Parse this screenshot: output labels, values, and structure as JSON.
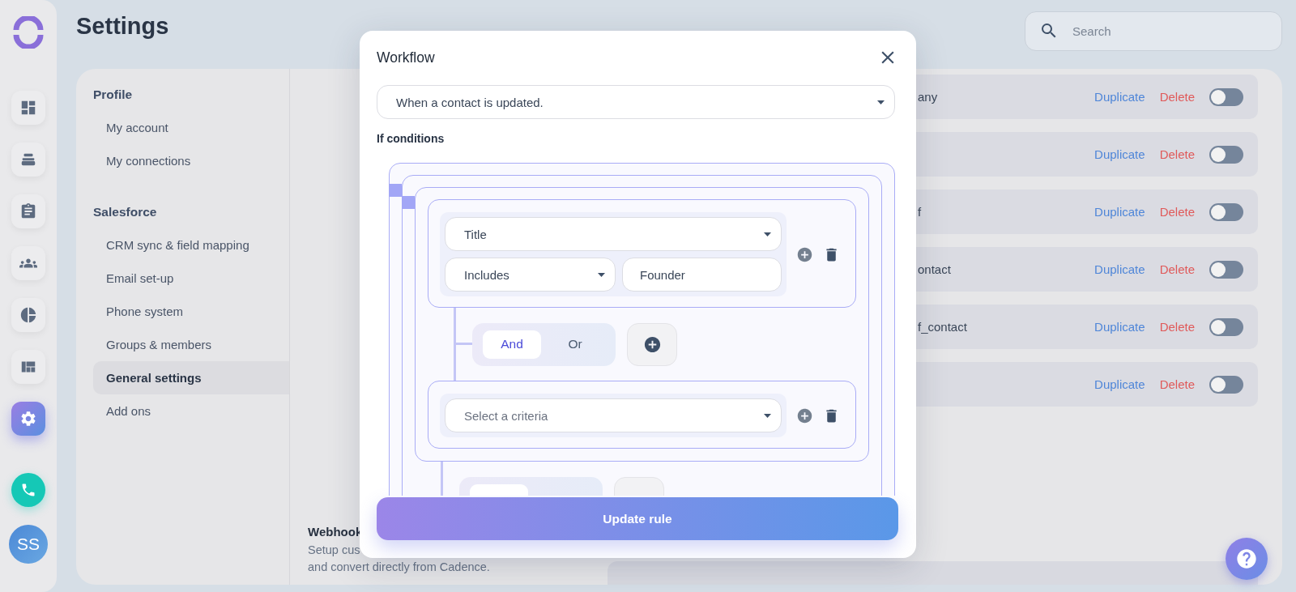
{
  "rail": {
    "items": [
      {
        "kind": "dashboard",
        "selected": false
      },
      {
        "kind": "trays",
        "selected": false
      },
      {
        "kind": "clipboard",
        "selected": false
      },
      {
        "kind": "people",
        "selected": false
      },
      {
        "kind": "pie",
        "selected": false
      },
      {
        "kind": "layout",
        "selected": false
      },
      {
        "kind": "settings",
        "selected": true
      }
    ],
    "avatar": {
      "initials": "SS"
    }
  },
  "page_title": "Settings",
  "search": {
    "placeholder": "Search"
  },
  "nav": {
    "sections": [
      {
        "title": "Profile",
        "items": [
          {
            "label": "My account",
            "selected": false
          },
          {
            "label": "My connections",
            "selected": false
          }
        ]
      },
      {
        "title": "Salesforce",
        "items": [
          {
            "label": "CRM sync & field mapping",
            "selected": false
          },
          {
            "label": "Email set-up",
            "selected": false
          },
          {
            "label": "Phone system",
            "selected": false
          },
          {
            "label": "Groups & members",
            "selected": false
          },
          {
            "label": "General settings",
            "selected": true
          },
          {
            "label": "Add ons",
            "selected": false
          }
        ]
      }
    ]
  },
  "rules": [
    {
      "label": "any",
      "duplicate": "Duplicate",
      "delete": "Delete",
      "on": false
    },
    {
      "duplicate": "Duplicate",
      "delete": "Delete",
      "on": false
    },
    {
      "label": "f",
      "duplicate": "Duplicate",
      "delete": "Delete",
      "on": false
    },
    {
      "label": "ontact",
      "duplicate": "Duplicate",
      "delete": "Delete",
      "on": false
    },
    {
      "label": "f_contact",
      "duplicate": "Duplicate",
      "delete": "Delete",
      "on": false
    },
    {
      "duplicate": "Duplicate",
      "delete": "Delete",
      "on": false
    }
  ],
  "webhook": {
    "title": "Webhook",
    "description_lines": [
      "Setup cus",
      "and convert directly from Cadence."
    ]
  },
  "modal": {
    "title": "Workflow",
    "trigger": {
      "value": "When a contact is updated."
    },
    "conditions_label": "If conditions",
    "condition_tree": {
      "kind": "group",
      "children": [
        {
          "kind": "group",
          "children": [
            {
              "kind": "group",
              "children": [
                {
                  "kind": "condition",
                  "criteria": {
                    "value": "Title"
                  },
                  "operator": {
                    "value": "Includes"
                  },
                  "value": {
                    "value": "Founder"
                  }
                },
                {
                  "kind": "connector",
                  "options": [
                    {
                      "label": "And",
                      "selected": true
                    },
                    {
                      "label": "Or",
                      "selected": false
                    }
                  ]
                },
                {
                  "kind": "condition",
                  "criteria": {
                    "placeholder": "Select a criteria"
                  }
                }
              ]
            },
            {
              "kind": "connector_cut"
            }
          ]
        }
      ]
    },
    "submit": "Update rule"
  }
}
